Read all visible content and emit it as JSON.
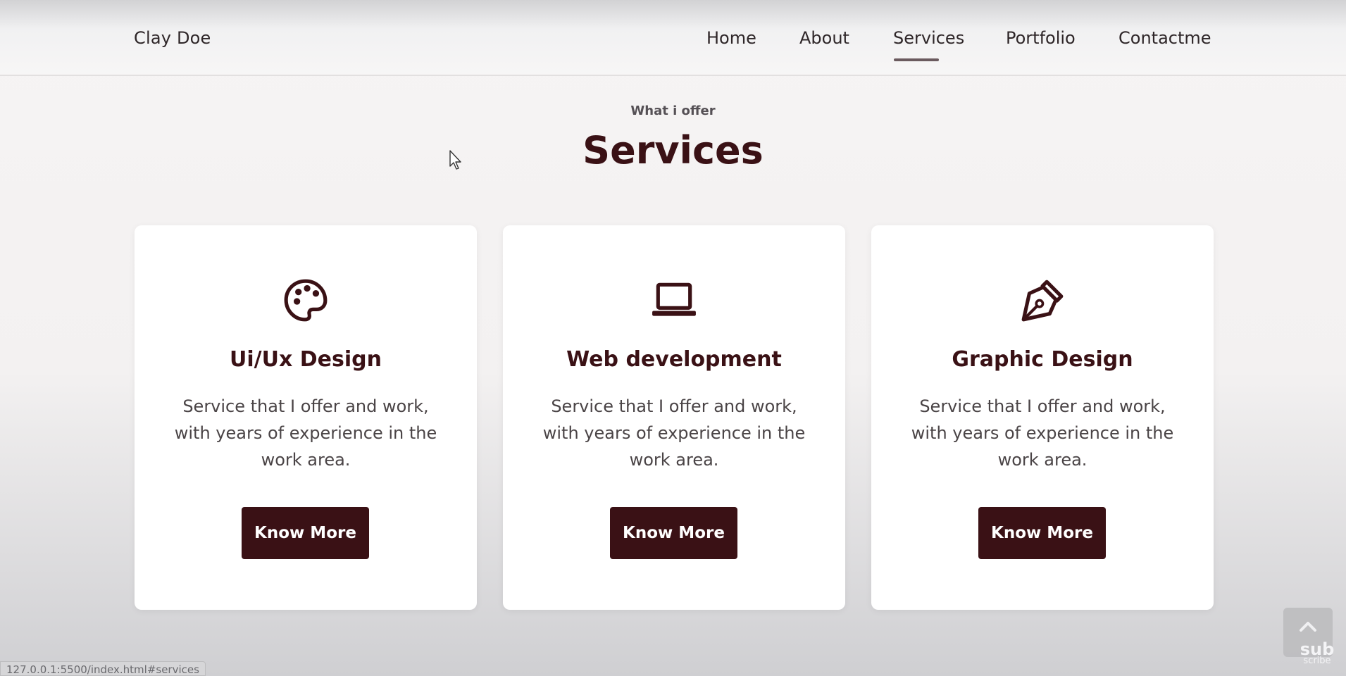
{
  "nav": {
    "brand": "Clay Doe",
    "links": [
      "Home",
      "About",
      "Services",
      "Portfolio",
      "Contactme"
    ],
    "active": "Services"
  },
  "section": {
    "eyebrow": "What i offer",
    "title": "Services"
  },
  "cards": [
    {
      "icon": "palette-icon",
      "title": "Ui/Ux Design",
      "text": "Service that I offer and work, with years of experience in the work area.",
      "button": "Know More"
    },
    {
      "icon": "laptop-icon",
      "title": "Web development",
      "text": "Service that I offer and work, with years of experience in the work area.",
      "button": "Know More"
    },
    {
      "icon": "pen-nib-icon",
      "title": "Graphic Design",
      "text": "Service that I offer and work, with years of experience in the work area.",
      "button": "Know More"
    }
  ],
  "status_bar": "127.0.0.1:5500/index.html#services",
  "subscribe_watermark": {
    "line1": "sub",
    "line2": "scribe"
  },
  "colors": {
    "accent": "#3a1115",
    "text": "#2e2628",
    "button_text": "#ffffff",
    "card_bg": "#ffffff"
  }
}
